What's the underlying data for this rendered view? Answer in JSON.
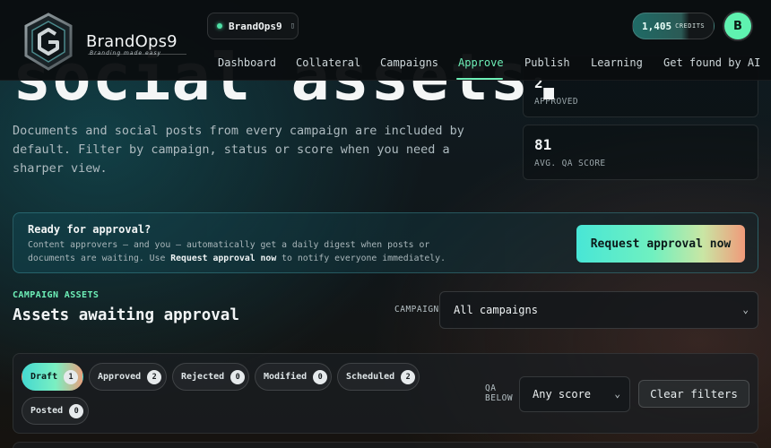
{
  "brand": {
    "name": "BrandOps9",
    "tagline": "Branding made easy"
  },
  "workspace": {
    "name": "BrandOps9",
    "chevron": "▯"
  },
  "credits": {
    "value": "1,405",
    "label": "CREDITS",
    "fill_percent": 70
  },
  "user": {
    "initial": "B"
  },
  "nav": {
    "items": [
      {
        "label": "Dashboard"
      },
      {
        "label": "Collateral"
      },
      {
        "label": "Campaigns"
      },
      {
        "label": "Approve"
      },
      {
        "label": "Publish"
      },
      {
        "label": "Learning"
      },
      {
        "label": "Get found by AI"
      }
    ],
    "active": "Approve"
  },
  "hero": {
    "title": "social assets.",
    "description": "Documents and social posts from every campaign are included by default. Filter by campaign, status or score when you need a sharper view."
  },
  "stats": [
    {
      "value": "2",
      "label": "APPROVED"
    },
    {
      "value": "81",
      "label": "AVG. QA SCORE"
    }
  ],
  "banner": {
    "title": "Ready for approval?",
    "text_before": "Content approvers — and you — automatically get a daily digest when posts or documents are waiting. Use ",
    "text_bold": "Request approval now",
    "text_after": " to notify everyone immediately.",
    "button_label": "Request approval now"
  },
  "assets": {
    "eyebrow": "CAMPAIGN ASSETS",
    "title": "Assets awaiting approval",
    "campaign_label": "CAMPAIGN",
    "campaign_value": "All campaigns",
    "filters": [
      {
        "label": "Draft",
        "count": "1",
        "active": true
      },
      {
        "label": "Approved",
        "count": "2",
        "active": false
      },
      {
        "label": "Rejected",
        "count": "0",
        "active": false
      },
      {
        "label": "Modified",
        "count": "0",
        "active": false
      },
      {
        "label": "Scheduled",
        "count": "2",
        "active": false
      },
      {
        "label": "Posted",
        "count": "0",
        "active": false
      }
    ],
    "qa_label": "QA BELOW",
    "qa_value": "Any score",
    "clear_label": "Clear filters"
  },
  "colors": {
    "accent": "#6ef0b8",
    "background": "#101619"
  }
}
